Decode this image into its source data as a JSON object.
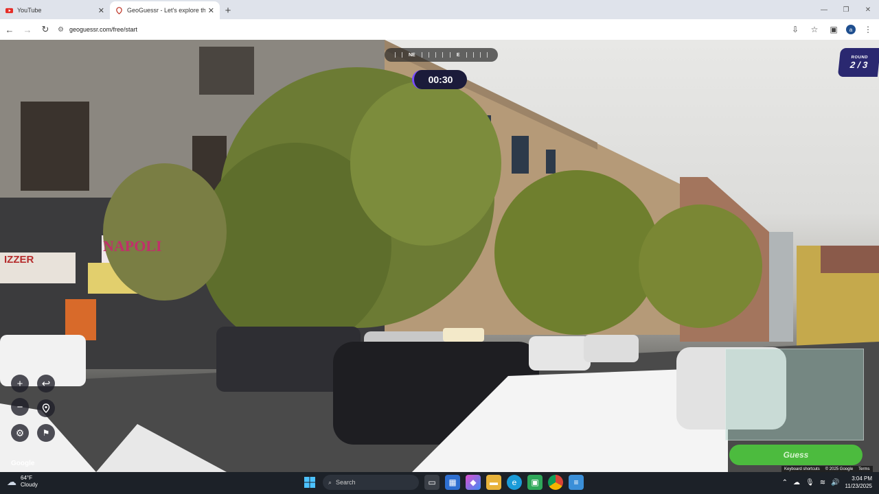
{
  "browser": {
    "tabs": [
      {
        "title": "YouTube",
        "active": false
      },
      {
        "title": "GeoGuessr - Let's explore the world",
        "active": true
      }
    ],
    "url": "geoguessr.com/free/start"
  },
  "game": {
    "compass": {
      "ne": "NE",
      "e": "E"
    },
    "timer": "00:30",
    "round_label": "ROUND",
    "round_value": "2 / 3",
    "zoom_in": "+",
    "zoom_out": "−",
    "undo": "↩",
    "google_logo": "Google",
    "guess_button": "Guess",
    "map_footer": {
      "shortcuts": "Keyboard shortcuts",
      "copyright": "© 2025 Google",
      "terms": "Terms"
    },
    "signs": {
      "napoli": "NAPOLI",
      "pizzeria": "IZZER"
    }
  },
  "taskbar": {
    "weather_temp": "64°F",
    "weather_cond": "Cloudy",
    "search_placeholder": "Search",
    "time": "3:04 PM",
    "date": "11/23/2025"
  },
  "colors": {
    "accent": "#2a2870",
    "guess": "#4cbb3e",
    "timer_bg": "#1b1b3a"
  }
}
